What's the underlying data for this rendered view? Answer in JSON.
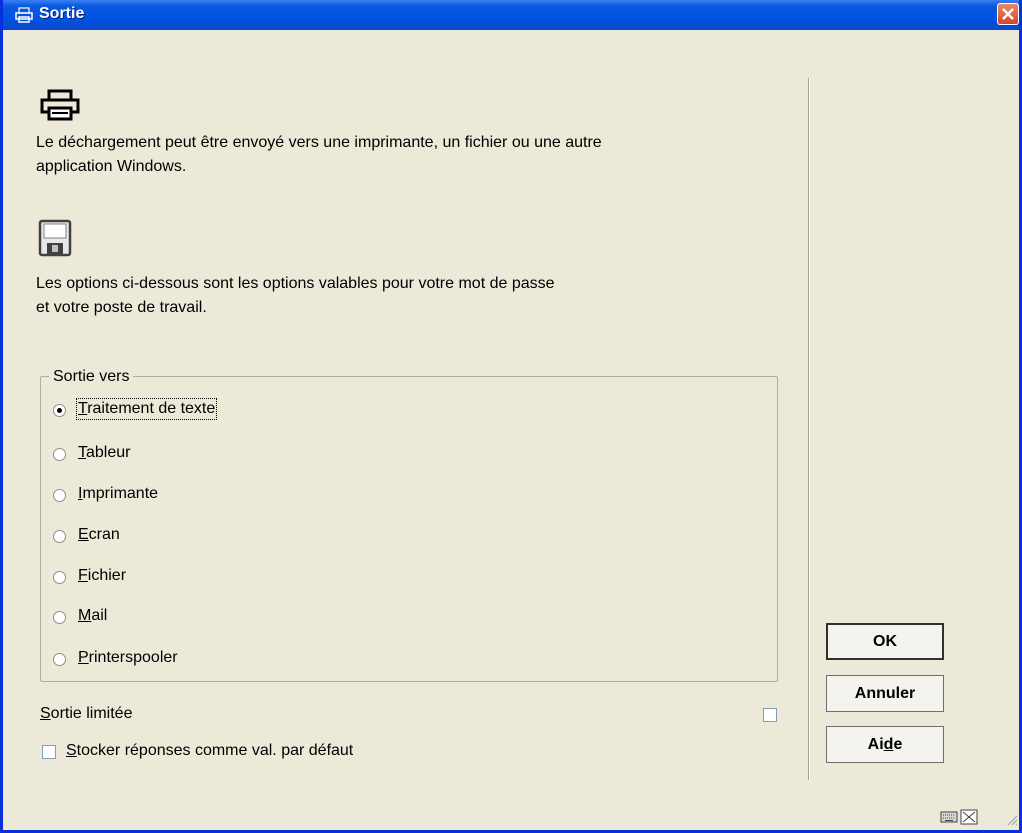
{
  "window": {
    "title": "Sortie",
    "close_label": "✕"
  },
  "info": {
    "output_text_1": "Le déchargement peut être envoyé vers une imprimante, un fichier ou une autre",
    "output_text_2": "application Windows.",
    "options_text_1": "Les options ci-dessous sont les options valables pour votre mot de passe",
    "options_text_2": "et votre poste de travail."
  },
  "output_group": {
    "legend": "Sortie vers",
    "options": [
      {
        "first": "T",
        "rest": "raitement de texte",
        "selected": true
      },
      {
        "first": "T",
        "rest": "ableur",
        "selected": false
      },
      {
        "first": "I",
        "rest": "mprimante",
        "selected": false
      },
      {
        "first": "E",
        "rest": "cran",
        "selected": false
      },
      {
        "first": "F",
        "rest": "ichier",
        "selected": false
      },
      {
        "first": "M",
        "rest": "ail",
        "selected": false
      },
      {
        "first": "P",
        "rest": "rinterspooler",
        "selected": false
      }
    ]
  },
  "limited": {
    "first": "S",
    "rest": "ortie limitée",
    "checked": false
  },
  "store_defaults": {
    "first": "S",
    "rest": "tocker réponses comme val. par défaut",
    "checked": false
  },
  "buttons": {
    "ok": "OK",
    "cancel": "Annuler",
    "help_pre": "Ai",
    "help_mnemonic": "d",
    "help_post": "e"
  },
  "icons": {
    "title": "printer-icon",
    "big_printer": "printer-icon",
    "big_save": "floppy-disk-icon",
    "status_keyboard": "keyboard-icon",
    "status_resize": "resize-icon"
  }
}
